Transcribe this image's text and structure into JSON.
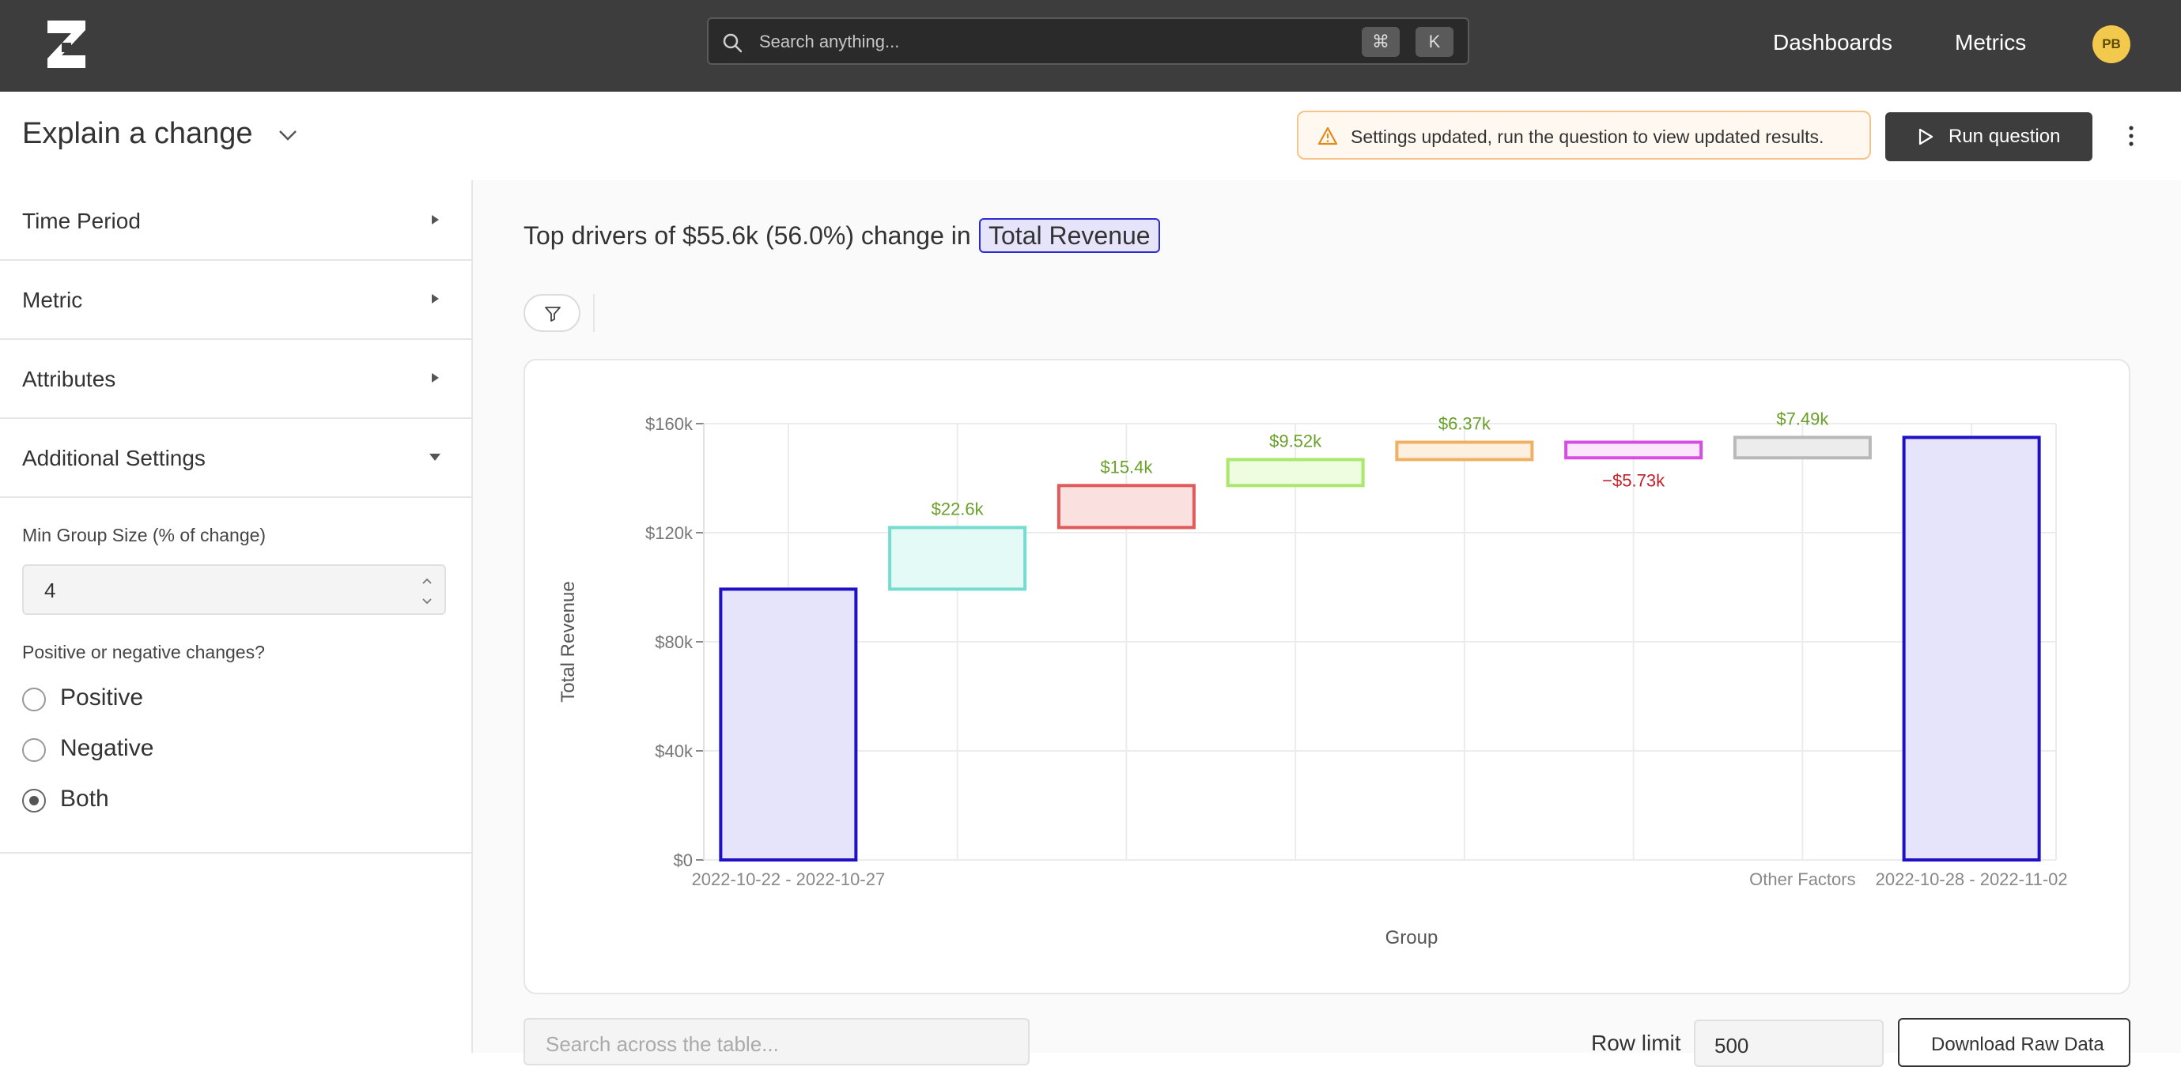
{
  "topbar": {
    "search_placeholder": "Search anything...",
    "shortcut_keys": [
      "⌘",
      "K"
    ],
    "nav": [
      "Dashboards",
      "Metrics"
    ],
    "avatar_initials": "PB"
  },
  "header": {
    "title": "Explain a change",
    "notice": "Settings updated, run the question to view updated results.",
    "run_label": "Run question"
  },
  "sidebar": {
    "sections": [
      {
        "label": "Time Period",
        "expanded": false
      },
      {
        "label": "Metric",
        "expanded": false
      },
      {
        "label": "Attributes",
        "expanded": false
      },
      {
        "label": "Additional Settings",
        "expanded": true
      }
    ],
    "min_group_label": "Min Group Size (% of change)",
    "min_group_value": "4",
    "direction_label": "Positive or negative changes?",
    "direction_options": [
      "Positive",
      "Negative",
      "Both"
    ],
    "direction_selected": "Both"
  },
  "main": {
    "heading": "Top drivers of $55.6k (56.0%) change in",
    "metric_tag": "Total Revenue",
    "table_search_placeholder": "Search across the table...",
    "row_limit_label": "Row limit",
    "row_limit_value": "500",
    "download_label": "Download Raw Data"
  },
  "chart_data": {
    "type": "bar",
    "subtype": "waterfall",
    "title": "",
    "xlabel": "Group",
    "ylabel": "Total Revenue",
    "ylim": [
      0,
      160000
    ],
    "yticks": [
      0,
      40000,
      80000,
      120000,
      160000
    ],
    "ytick_labels": [
      "$0",
      "$40k",
      "$80k",
      "$120k",
      "$160k"
    ],
    "grid": true,
    "bars": [
      {
        "category": "2022-10-22 - 2022-10-27",
        "base": 0,
        "value": 99300,
        "label": "",
        "fill": "#e5e4fb",
        "stroke": "#1f10c7"
      },
      {
        "category": "",
        "base": 99300,
        "value": 22600,
        "label": "$22.6k",
        "fill": "#e3faf6",
        "stroke": "#76dccf"
      },
      {
        "category": "",
        "base": 121900,
        "value": 15400,
        "label": "$15.4k",
        "fill": "#fbe0e0",
        "stroke": "#e05a5a"
      },
      {
        "category": "",
        "base": 137300,
        "value": 9520,
        "label": "$9.52k",
        "fill": "#eefde0",
        "stroke": "#a9e86a"
      },
      {
        "category": "",
        "base": 146820,
        "value": 6370,
        "label": "$6.37k",
        "fill": "#fdf0e0",
        "stroke": "#f0b063"
      },
      {
        "category": "",
        "base": 147460,
        "value": 5730,
        "label": "−$5.73k",
        "negative": true,
        "fill": "#fbe6fb",
        "stroke": "#d64ee0"
      },
      {
        "category": "Other Factors",
        "base": 147460,
        "value": 7490,
        "label": "$7.49k",
        "fill": "#ececec",
        "stroke": "#b8b8b8"
      },
      {
        "category": "2022-10-28 - 2022-11-02",
        "base": 0,
        "value": 154950,
        "label": "",
        "fill": "#e5e4fb",
        "stroke": "#1f10c7"
      }
    ],
    "positive_label_color": "#6aa02a",
    "negative_label_color": "#c0202a"
  }
}
